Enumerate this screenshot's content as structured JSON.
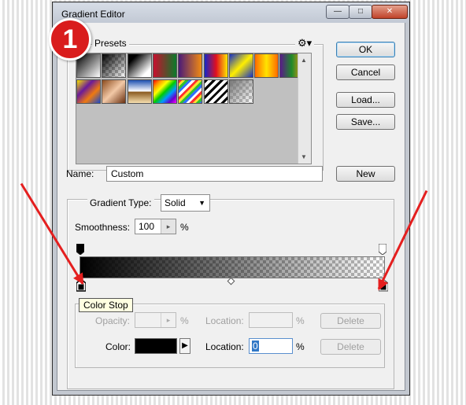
{
  "window": {
    "title": "Gradient Editor",
    "controls": {
      "minimize": "—",
      "maximize": "□",
      "close": "✕"
    }
  },
  "badge": {
    "number": "1",
    "color": "#d91c1c"
  },
  "presets": {
    "label": "Presets",
    "menu_icon": "gear-icon",
    "swatches": [
      {
        "name": "foreground-to-background",
        "css": "linear-gradient(135deg,#000,#fff)"
      },
      {
        "name": "foreground-to-transparent",
        "css": "linear-gradient(135deg,#000,transparent)"
      },
      {
        "name": "black-white",
        "css": "linear-gradient(135deg,#000 20%,#fff 80%)"
      },
      {
        "name": "red-green",
        "css": "linear-gradient(90deg,#c8102e,#0a7a2a)"
      },
      {
        "name": "violet-orange",
        "css": "linear-gradient(90deg,#4a1a78,#f18a12)"
      },
      {
        "name": "blue-red-yellow",
        "css": "linear-gradient(90deg,#1427c9,#e10f1f,#ffe800)"
      },
      {
        "name": "blue-yellow-blue",
        "css": "linear-gradient(135deg,#1530c5,#ffef00 50%,#1530c5)"
      },
      {
        "name": "orange-yellow-orange",
        "css": "linear-gradient(90deg,#ff6a00,#ffe400 50%,#ff6a00)"
      },
      {
        "name": "violet-green-orange",
        "css": "linear-gradient(90deg,#5a1a8a,#1f8a2a 50%,#f19a12)"
      },
      {
        "name": "yellow-violet-orange-blue",
        "css": "linear-gradient(135deg,#f7e300,#6a1a9a 35%,#ef7a10 65%,#1a4acb)"
      },
      {
        "name": "copper",
        "css": "linear-gradient(135deg,#8b4a1c,#f2c8a6 50%,#6a3010)"
      },
      {
        "name": "chrome",
        "css": "linear-gradient(180deg,#1c4fb0,#fff 48%,#8a5a20 52%,#f7e0b0)"
      },
      {
        "name": "spectrum",
        "css": "linear-gradient(135deg,#ff0000,#ff9900,#ffff00,#00cc00,#0099ff,#6600cc,#ff00ff)"
      },
      {
        "name": "transparent-rainbow",
        "css": "repeating-linear-gradient(135deg,#ff3030 0 3px,#ffe030 3px 6px,#30c030 6px 9px,#3070ff 9px 12px,#fff 12px 15px)"
      },
      {
        "name": "transparent-stripes",
        "css": "repeating-linear-gradient(135deg,#000 0 3px,#fff 3px 7px)"
      },
      {
        "name": "neutral-density",
        "css": "linear-gradient(135deg,#777,transparent)"
      }
    ]
  },
  "buttons": {
    "ok": "OK",
    "cancel": "Cancel",
    "load": "Load...",
    "save": "Save...",
    "new": "New",
    "delete_opacity": "Delete",
    "delete_color": "Delete"
  },
  "name": {
    "label": "Name:",
    "value": "Custom"
  },
  "gradient_type": {
    "label": "Gradient Type:",
    "value": "Solid"
  },
  "smoothness": {
    "label": "Smoothness:",
    "value": "100",
    "unit": "%"
  },
  "tooltip": {
    "text": "Color Stop"
  },
  "stops": {
    "opacity": {
      "label": "Opacity:",
      "value": "",
      "unit": "%",
      "location_label": "Location:",
      "location_value": "",
      "location_unit": "%"
    },
    "color": {
      "label": "Color:",
      "swatch": "#000000",
      "location_label": "Location:",
      "location_value": "0",
      "location_unit": "%"
    }
  },
  "gradient_bar": {
    "start_color": "#000000"
  },
  "annotation": {
    "arrow_color": "#e41f1f"
  }
}
